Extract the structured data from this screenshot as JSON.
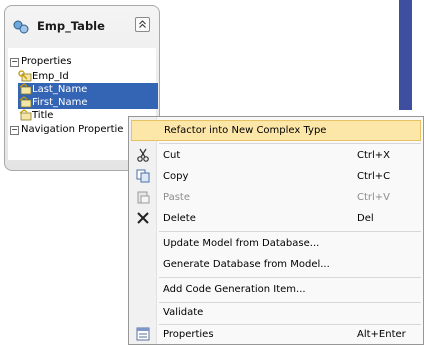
{
  "entity": {
    "title": "Emp_Table",
    "collapse_glyph": "⌃",
    "properties_section": "Properties",
    "properties": [
      {
        "label": "Emp_Id",
        "selected": false,
        "icon": "key-property-icon"
      },
      {
        "label": "Last_Name",
        "selected": true,
        "icon": "property-icon"
      },
      {
        "label": "First_Name",
        "selected": true,
        "icon": "property-icon"
      },
      {
        "label": "Title",
        "selected": false,
        "icon": "property-icon"
      }
    ],
    "navigation_section": "Navigation Propertie"
  },
  "context_menu": {
    "items": [
      {
        "label": "Refactor into New Complex Type",
        "shortcut": "",
        "icon": "",
        "highlighted": true,
        "disabled": false
      },
      {
        "label": "Cut",
        "shortcut": "Ctrl+X",
        "icon": "scissors-icon",
        "disabled": false
      },
      {
        "label": "Copy",
        "shortcut": "Ctrl+C",
        "icon": "copy-icon",
        "disabled": false
      },
      {
        "label": "Paste",
        "shortcut": "Ctrl+V",
        "icon": "paste-icon",
        "disabled": true
      },
      {
        "label": "Delete",
        "shortcut": "Del",
        "icon": "delete-icon",
        "disabled": false
      },
      {
        "label": "Update Model from Database...",
        "shortcut": "",
        "icon": "",
        "disabled": false
      },
      {
        "label": "Generate Database from Model...",
        "shortcut": "",
        "icon": "",
        "disabled": false
      },
      {
        "label": "Add Code Generation Item...",
        "shortcut": "",
        "icon": "",
        "disabled": false
      },
      {
        "label": "Validate",
        "shortcut": "",
        "icon": "",
        "disabled": false
      },
      {
        "label": "Properties",
        "shortcut": "Alt+Enter",
        "icon": "properties-icon",
        "disabled": false
      }
    ]
  },
  "colors": {
    "selection": "#3464b4",
    "menu_highlight": "#fde7a8",
    "designer_strip": "#3d4f9e"
  }
}
